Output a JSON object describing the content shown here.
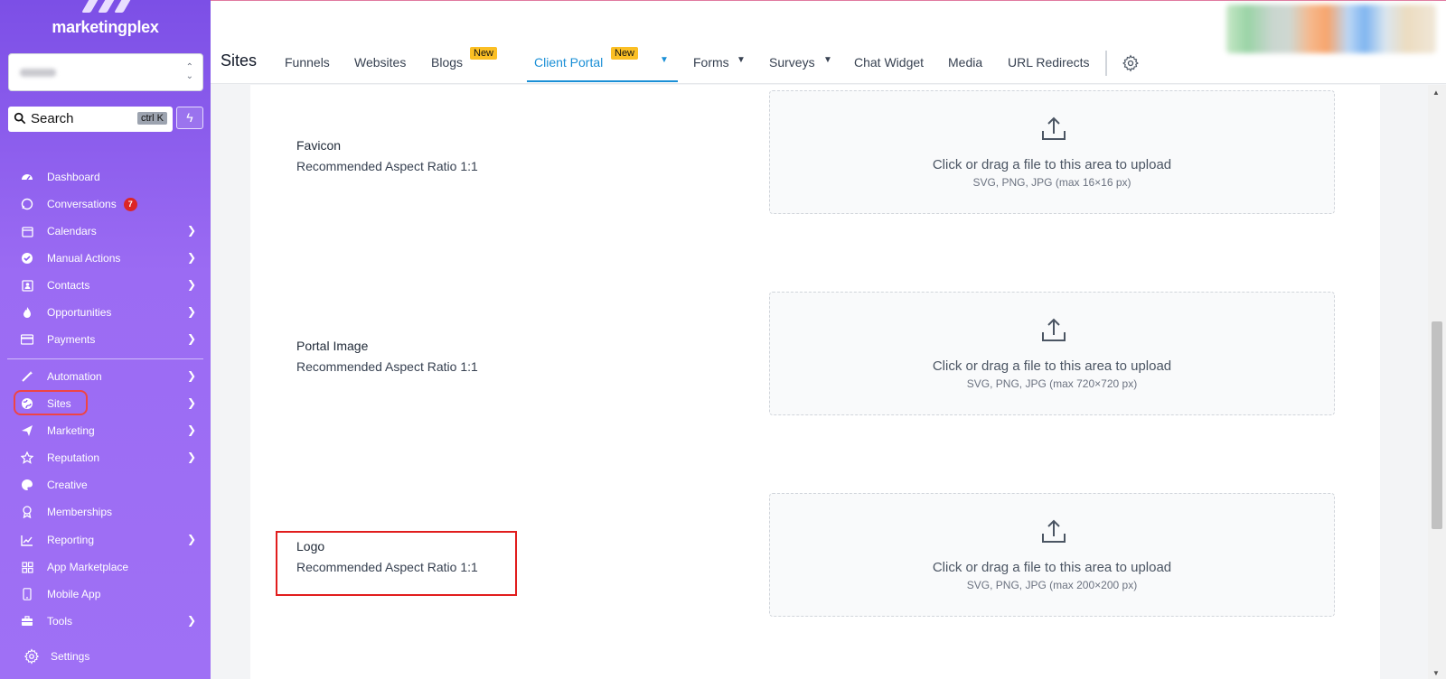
{
  "brand": {
    "name": "marketingplex"
  },
  "account": {
    "name": "Demo - US"
  },
  "search": {
    "label": "Search",
    "shortcut": "ctrl K"
  },
  "sidebar": {
    "items": [
      {
        "label": "Dashboard",
        "icon": "dashboard-icon"
      },
      {
        "label": "Conversations",
        "icon": "chat-icon",
        "badge": "7"
      },
      {
        "label": "Calendars",
        "icon": "calendar-icon"
      },
      {
        "label": "Manual Actions",
        "icon": "check-circle-icon"
      },
      {
        "label": "Contacts",
        "icon": "contact-card-icon"
      },
      {
        "label": "Opportunities",
        "icon": "flame-icon"
      },
      {
        "label": "Payments",
        "icon": "credit-card-icon"
      },
      {
        "label": "Automation",
        "icon": "magic-wand-icon"
      },
      {
        "label": "Sites",
        "icon": "globe-icon"
      },
      {
        "label": "Marketing",
        "icon": "send-icon"
      },
      {
        "label": "Reputation",
        "icon": "star-icon"
      },
      {
        "label": "Creative",
        "icon": "palette-icon"
      },
      {
        "label": "Memberships",
        "icon": "badge-icon"
      },
      {
        "label": "Reporting",
        "icon": "chart-icon"
      },
      {
        "label": "App Marketplace",
        "icon": "grid-icon"
      },
      {
        "label": "Mobile App",
        "icon": "phone-icon"
      },
      {
        "label": "Tools",
        "icon": "toolbox-icon"
      }
    ],
    "settings_label": "Settings"
  },
  "topbar": {
    "title": "Sites",
    "tabs": [
      {
        "label": "Funnels"
      },
      {
        "label": "Websites"
      },
      {
        "label": "Blogs",
        "badge": "New"
      },
      {
        "label": "Client Portal",
        "badge": "New",
        "active": true
      },
      {
        "label": "Forms"
      },
      {
        "label": "Surveys"
      },
      {
        "label": "Chat Widget"
      },
      {
        "label": "Media"
      },
      {
        "label": "URL Redirects"
      }
    ]
  },
  "fields": [
    {
      "label": "Favicon",
      "hint": "Recommended Aspect Ratio 1:1",
      "upload_message": "Click or drag a file to this area to upload",
      "formats": "SVG, PNG, JPG (max 16×16 px)"
    },
    {
      "label": "Portal Image",
      "hint": "Recommended Aspect Ratio 1:1",
      "upload_message": "Click or drag a file to this area to upload",
      "formats": "SVG, PNG, JPG (max 720×720 px)"
    },
    {
      "label": "Logo",
      "hint": "Recommended Aspect Ratio 1:1",
      "upload_message": "Click or drag a file to this area to upload",
      "formats": "SVG, PNG, JPG (max 200×200 px)"
    }
  ],
  "colors": {
    "sidebar": "#8b5cf6",
    "accent": "#1a8fd6",
    "badge": "#fbbf24",
    "highlight": "#e11d1d"
  }
}
